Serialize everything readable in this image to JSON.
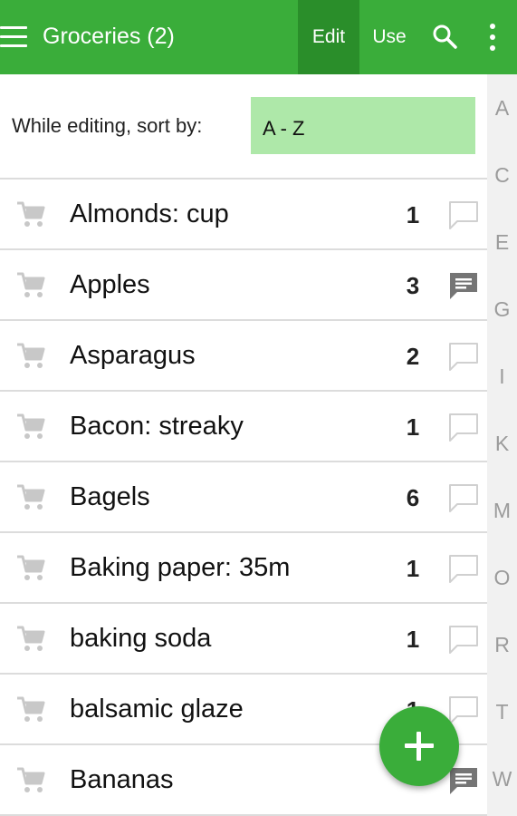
{
  "header": {
    "title": "Groceries (2)",
    "edit_label": "Edit",
    "use_label": "Use"
  },
  "sort": {
    "label": "While editing, sort by:",
    "value": "A - Z"
  },
  "items": [
    {
      "name": "Almonds: cup",
      "qty": "1",
      "has_note": false
    },
    {
      "name": "Apples",
      "qty": "3",
      "has_note": true
    },
    {
      "name": "Asparagus",
      "qty": "2",
      "has_note": false
    },
    {
      "name": "Bacon: streaky",
      "qty": "1",
      "has_note": false
    },
    {
      "name": "Bagels",
      "qty": "6",
      "has_note": false
    },
    {
      "name": "Baking paper: 35m",
      "qty": "1",
      "has_note": false
    },
    {
      "name": "baking soda",
      "qty": "1",
      "has_note": false
    },
    {
      "name": "balsamic glaze",
      "qty": "1",
      "has_note": false
    },
    {
      "name": "Bananas",
      "qty": "",
      "has_note": true
    }
  ],
  "index_letters": [
    "A",
    "C",
    "E",
    "G",
    "I",
    "K",
    "M",
    "O",
    "R",
    "T",
    "W"
  ],
  "icons": {
    "menu": "menu-icon",
    "search": "search-icon",
    "more": "more-vert-icon",
    "cart": "cart-icon",
    "note": "comment-icon",
    "fab": "add-icon"
  },
  "colors": {
    "primary": "#3aad3a",
    "primary_dark": "#2a8e2a",
    "sort_highlight": "#aee8a9",
    "icon_gray": "#c8c8c8",
    "note_filled": "#757575",
    "index_text": "#9b9b9b"
  }
}
